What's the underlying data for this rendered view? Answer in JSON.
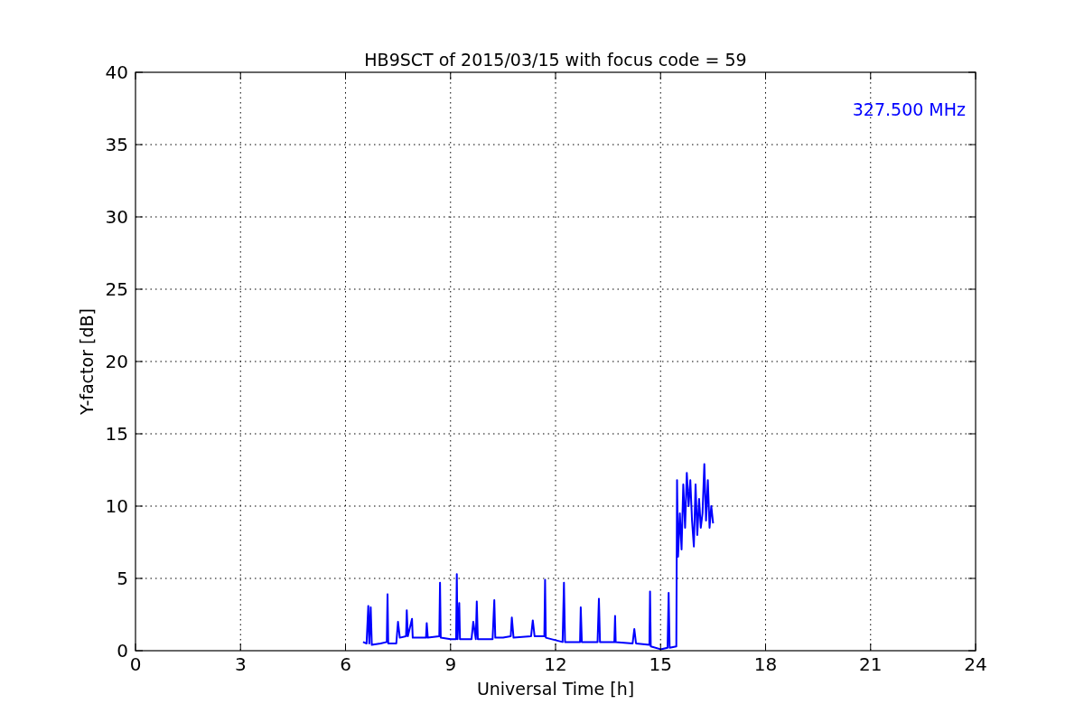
{
  "chart_data": {
    "type": "line",
    "title": "HB9SCT of 2015/03/15 with focus code = 59",
    "xlabel": "Universal Time [h]",
    "ylabel": "Y-factor [dB]",
    "x": [
      6.5,
      6.6,
      6.65,
      6.68,
      6.72,
      6.75,
      7.0,
      7.18,
      7.2,
      7.22,
      7.45,
      7.5,
      7.55,
      7.73,
      7.75,
      7.78,
      7.9,
      7.92,
      8.3,
      8.32,
      8.35,
      8.68,
      8.7,
      8.72,
      9.0,
      9.16,
      9.18,
      9.2,
      9.25,
      9.27,
      9.6,
      9.65,
      9.72,
      9.75,
      9.78,
      10.2,
      10.25,
      10.28,
      10.5,
      10.72,
      10.75,
      10.8,
      11.3,
      11.35,
      11.4,
      11.68,
      11.7,
      11.72,
      12.2,
      12.24,
      12.27,
      12.7,
      12.72,
      12.75,
      13.2,
      13.24,
      13.27,
      13.68,
      13.7,
      13.72,
      14.2,
      14.25,
      14.3,
      14.68,
      14.7,
      14.72,
      15.0,
      15.2,
      15.23,
      15.26,
      15.45,
      15.47,
      15.5,
      15.55,
      15.6,
      15.65,
      15.7,
      15.75,
      15.8,
      15.85,
      15.9,
      15.95,
      16.0,
      16.05,
      16.1,
      16.15,
      16.2,
      16.25,
      16.3,
      16.35,
      16.4,
      16.45,
      16.5
    ],
    "series": [
      {
        "name": "327.500 MHz",
        "color": "#0000ff",
        "values": [
          0.6,
          0.5,
          3.1,
          0.5,
          3.0,
          0.4,
          0.5,
          0.6,
          3.9,
          0.5,
          0.5,
          2.0,
          0.9,
          1.0,
          2.8,
          1.0,
          2.2,
          0.9,
          0.9,
          1.9,
          0.9,
          1.0,
          4.7,
          0.9,
          0.8,
          0.8,
          5.3,
          0.8,
          3.3,
          0.8,
          0.8,
          2.0,
          0.8,
          3.4,
          0.8,
          0.8,
          3.5,
          0.9,
          0.9,
          1.0,
          2.3,
          0.9,
          1.0,
          2.1,
          1.0,
          1.0,
          4.9,
          0.9,
          0.6,
          4.7,
          0.6,
          0.6,
          3.0,
          0.6,
          0.6,
          3.6,
          0.6,
          0.6,
          2.4,
          0.6,
          0.5,
          1.5,
          0.5,
          0.4,
          4.1,
          0.3,
          0.1,
          0.2,
          4.0,
          0.2,
          0.3,
          11.8,
          6.5,
          9.5,
          7.0,
          11.5,
          8.5,
          12.3,
          10.0,
          11.8,
          9.0,
          7.2,
          11.5,
          8.0,
          10.5,
          8.5,
          9.5,
          12.9,
          9.0,
          11.8,
          8.5,
          10.0,
          8.8
        ]
      }
    ],
    "xlim": [
      0,
      24
    ],
    "ylim": [
      0,
      40
    ],
    "xticks": [
      0,
      3,
      6,
      9,
      12,
      15,
      18,
      21,
      24
    ],
    "yticks": [
      0,
      5,
      10,
      15,
      20,
      25,
      30,
      35,
      40
    ],
    "grid": true
  }
}
